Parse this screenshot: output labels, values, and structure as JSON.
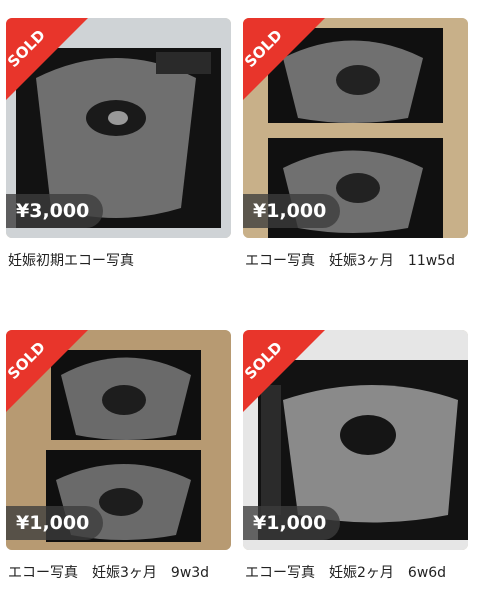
{
  "items": [
    {
      "title": "妊娠初期エコー写真",
      "price": "¥3,000",
      "sold": "SOLD"
    },
    {
      "title": "エコー写真　妊娠3ヶ月　11w5d",
      "price": "¥1,000",
      "sold": "SOLD"
    },
    {
      "title": "エコー写真　妊娠3ヶ月　9w3d",
      "price": "¥1,000",
      "sold": "SOLD"
    },
    {
      "title": "エコー写真　妊娠2ヶ月　6w6d",
      "price": "¥1,000",
      "sold": "SOLD"
    }
  ],
  "colors": {
    "sold_red": "#e8352b",
    "price_bg": "#3c3c3c"
  }
}
